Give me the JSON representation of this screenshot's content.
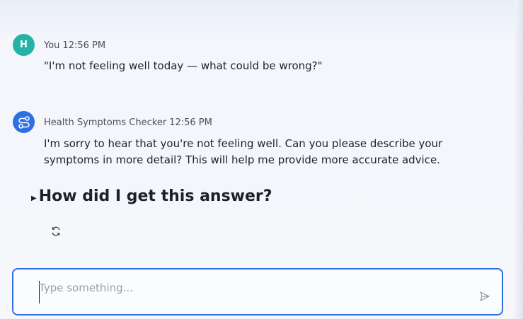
{
  "messages": [
    {
      "sender": "You",
      "time": "12:56 PM",
      "avatar_letter": "H",
      "text": "\"I'm not feeling well today — what could be wrong?\""
    },
    {
      "sender": "Health Symptoms Checker",
      "time": "12:56 PM",
      "avatar_icon": "bot-route-icon",
      "text": "I'm sorry to hear that you're not feeling well. Can you please describe your symptoms in more detail? This will help me provide more accurate advice."
    }
  ],
  "expander": {
    "label": "How did I get this answer?",
    "icon": "triangle-right-icon"
  },
  "actions": {
    "regenerate_icon": "refresh-icon"
  },
  "composer": {
    "placeholder": "Type something...",
    "value": "",
    "send_icon": "send-icon"
  },
  "colors": {
    "accent": "#2e6fe6",
    "user_avatar": "#25b3a7"
  }
}
